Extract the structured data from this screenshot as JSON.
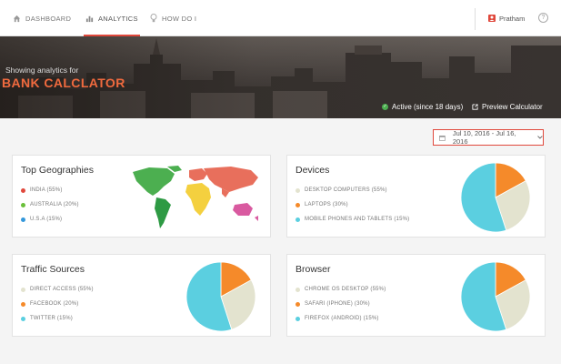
{
  "nav": {
    "items": [
      {
        "label": "DASHBOARD",
        "icon": "home-icon",
        "active": false
      },
      {
        "label": "ANALYTICS",
        "icon": "bar-chart-icon",
        "active": true
      },
      {
        "label": "HOW DO I",
        "icon": "lightbulb-icon",
        "active": false
      }
    ],
    "user_name": "Pratham",
    "help_glyph": "?",
    "accent_color": "#e0483c"
  },
  "banner": {
    "subtitle": "Showing analytics for",
    "title": "BANK CALCLATOR",
    "status": "Active (since 18 days)",
    "preview_label": "Preview Calculator",
    "title_color": "#f06a3e"
  },
  "date_range": "Jul 10, 2016 - Jul 16, 2016",
  "cards": {
    "geo": {
      "title": "Top Geographies",
      "legend": [
        {
          "label": "INDIA (55%)",
          "color": "#e0483c"
        },
        {
          "label": "AUSTRALIA (20%)",
          "color": "#6abf3a"
        },
        {
          "label": "U.S.A (15%)",
          "color": "#3498db"
        }
      ]
    },
    "devices": {
      "title": "Devices",
      "legend": [
        {
          "label": "DESKTOP COMPUTERS (55%)",
          "color": "#e3e3cf"
        },
        {
          "label": "LAPTOPS (30%)",
          "color": "#f58a2a"
        },
        {
          "label": "MOBILE PHONES AND TABLETS (15%)",
          "color": "#5bcfe0"
        }
      ]
    },
    "traffic": {
      "title": "Traffic Sources",
      "legend": [
        {
          "label": "DIRECT ACCESS (55%)",
          "color": "#e3e3cf"
        },
        {
          "label": "FACEBOOK (20%)",
          "color": "#f58a2a"
        },
        {
          "label": "TWITTER (15%)",
          "color": "#5bcfe0"
        }
      ]
    },
    "browser": {
      "title": "Browser",
      "legend": [
        {
          "label": "CHROME OS DESKTOP (55%)",
          "color": "#e3e3cf"
        },
        {
          "label": "SAFARI (IPHONE) (30%)",
          "color": "#f58a2a"
        },
        {
          "label": "FIREFOX (ANDROID) (15%)",
          "color": "#5bcfe0"
        }
      ]
    }
  },
  "chart_data": [
    {
      "type": "pie",
      "chart": "devices",
      "slices": [
        {
          "color": "#f58a2a",
          "fraction": 0.17
        },
        {
          "color": "#e3e3cf",
          "fraction": 0.28
        },
        {
          "color": "#5bcfe0",
          "fraction": 0.55
        }
      ]
    },
    {
      "type": "pie",
      "chart": "traffic",
      "slices": [
        {
          "color": "#f58a2a",
          "fraction": 0.17
        },
        {
          "color": "#e3e3cf",
          "fraction": 0.28
        },
        {
          "color": "#5bcfe0",
          "fraction": 0.55
        }
      ]
    },
    {
      "type": "pie",
      "chart": "browser",
      "slices": [
        {
          "color": "#f58a2a",
          "fraction": 0.17
        },
        {
          "color": "#e3e3cf",
          "fraction": 0.28
        },
        {
          "color": "#5bcfe0",
          "fraction": 0.55
        }
      ]
    }
  ]
}
